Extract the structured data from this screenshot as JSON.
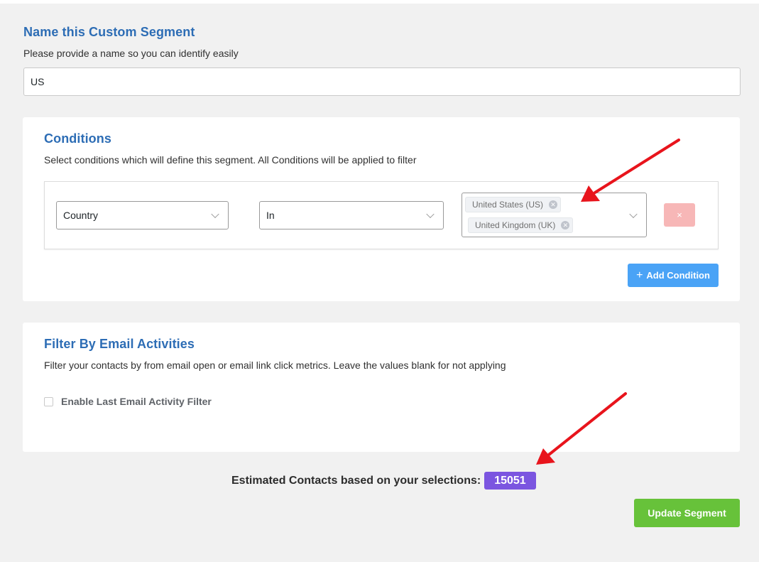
{
  "segment_name": {
    "title": "Name this Custom Segment",
    "description": "Please provide a name so you can identify easily",
    "value": "US"
  },
  "conditions": {
    "title": "Conditions",
    "description": "Select conditions which will define this segment. All Conditions will be applied to filter",
    "rows": [
      {
        "field": "Country",
        "operator": "In",
        "values": [
          "United States (US)",
          "United Kingdom (UK)"
        ],
        "remove_label": "×"
      }
    ],
    "add_label": "Add Condition",
    "add_icon": "+"
  },
  "email_filter": {
    "title": "Filter By Email Activities",
    "description": "Filter your contacts by from email open or email link click metrics. Leave the values blank for not applying",
    "checkbox_label": "Enable Last Email Activity Filter",
    "checked": false
  },
  "estimate": {
    "label": "Estimated Contacts based on your selections:",
    "count": "15051"
  },
  "update_button": "Update Segment",
  "colors": {
    "heading": "#2d6db5",
    "primary_button": "#4aa3f6",
    "success_button": "#67c23a",
    "danger_button": "#f7b7b7",
    "count_badge": "#7b55e0",
    "annotation_arrow": "#e8141c"
  }
}
